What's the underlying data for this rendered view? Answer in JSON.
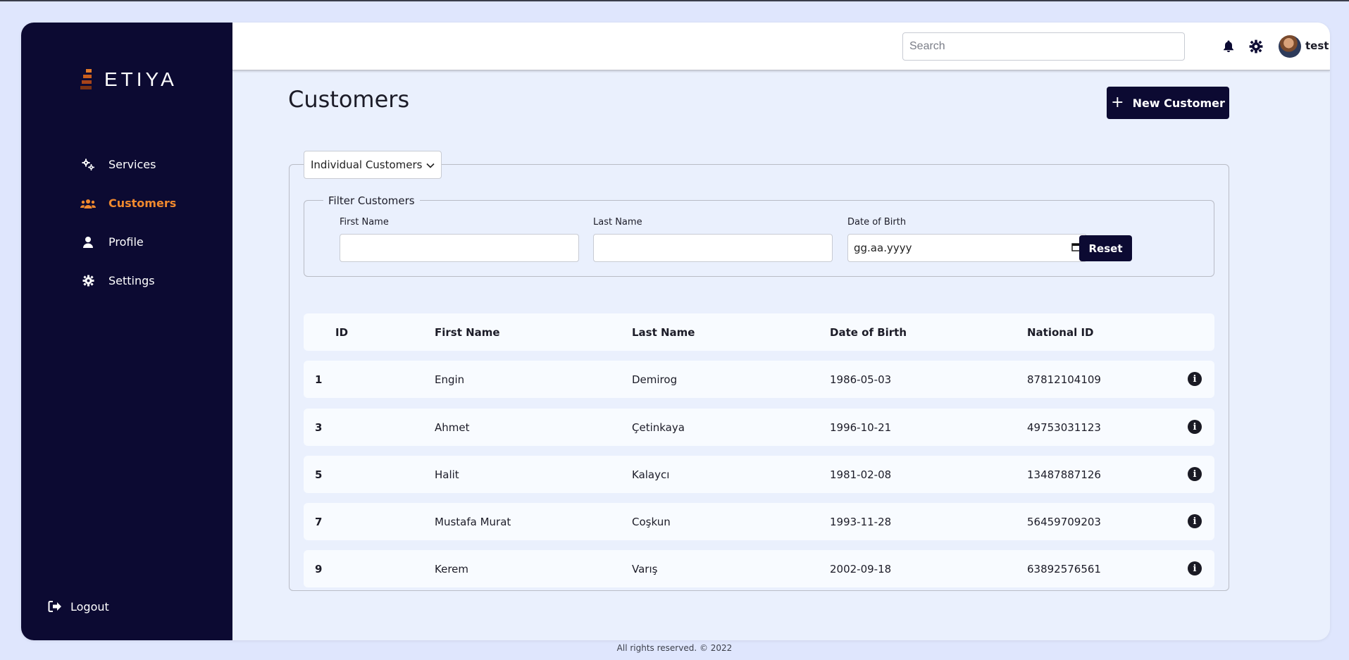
{
  "app": {
    "logo_text": "ETIYA"
  },
  "sidebar": {
    "items": [
      {
        "label": "Services",
        "icon": "gears-icon",
        "active": false
      },
      {
        "label": "Customers",
        "icon": "users-icon",
        "active": true
      },
      {
        "label": "Profile",
        "icon": "user-icon",
        "active": false
      },
      {
        "label": "Settings",
        "icon": "gear-icon",
        "active": false
      }
    ],
    "logout_label": "Logout"
  },
  "topbar": {
    "search_placeholder": "Search",
    "user_name": "test"
  },
  "page": {
    "title": "Customers",
    "new_button_label": "New Customer",
    "customer_type_selected": "Individual Customers"
  },
  "filter": {
    "legend": "Filter Customers",
    "first_name_label": "First Name",
    "last_name_label": "Last Name",
    "dob_label": "Date of Birth",
    "dob_placeholder": "gg.aa.yyyy",
    "reset_label": "Reset"
  },
  "table": {
    "columns": [
      "ID",
      "First Name",
      "Last Name",
      "Date of Birth",
      "National ID"
    ],
    "rows": [
      {
        "id": "1",
        "first_name": "Engin",
        "last_name": "Demirog",
        "dob": "1986-05-03",
        "national_id": "87812104109"
      },
      {
        "id": "3",
        "first_name": "Ahmet",
        "last_name": "Çetinkaya",
        "dob": "1996-10-21",
        "national_id": "49753031123"
      },
      {
        "id": "5",
        "first_name": "Halit",
        "last_name": "Kalaycı",
        "dob": "1981-02-08",
        "national_id": "13487887126"
      },
      {
        "id": "7",
        "first_name": "Mustafa Murat",
        "last_name": "Coşkun",
        "dob": "1993-11-28",
        "national_id": "56459709203"
      },
      {
        "id": "9",
        "first_name": "Kerem",
        "last_name": "Varış",
        "dob": "2002-09-18",
        "national_id": "63892576561"
      }
    ]
  },
  "footer": {
    "text": "All rights reserved. © 2022"
  },
  "colors": {
    "sidebar_bg": "#0c0a32",
    "accent": "#f0892e",
    "page_bg": "#eaf0fd"
  }
}
